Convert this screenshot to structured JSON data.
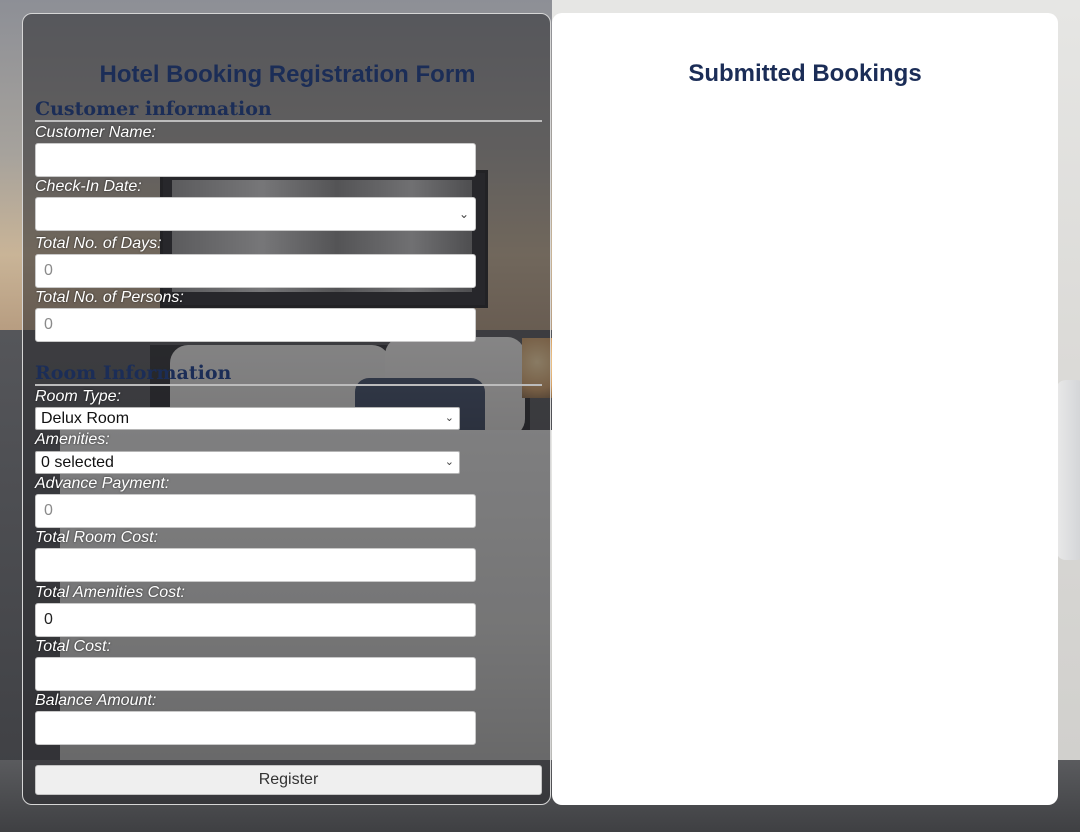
{
  "form": {
    "title": "Hotel Booking Registration Form",
    "customer_section": "Customer information",
    "customer_name_label": "Customer Name:",
    "customer_name_value": "",
    "checkin_label": "Check-In Date:",
    "checkin_value": "",
    "days_label": "Total No. of Days:",
    "days_placeholder": "0",
    "persons_label": "Total No. of Persons:",
    "persons_placeholder": "0",
    "room_section": "Room Information",
    "room_type_label": "Room Type:",
    "room_type_value": "Delux Room",
    "amenities_label": "Amenities:",
    "amenities_value": "0 selected",
    "advance_label": "Advance Payment:",
    "advance_placeholder": "0",
    "room_cost_label": "Total Room Cost:",
    "room_cost_value": "",
    "amenities_cost_label": "Total Amenities Cost:",
    "amenities_cost_value": "0",
    "total_cost_label": "Total Cost:",
    "total_cost_value": "",
    "balance_label": "Balance Amount:",
    "balance_value": "",
    "register_label": "Register"
  },
  "bookings": {
    "title": "Submitted Bookings"
  },
  "icons": {
    "dropdown": "chevron-down-icon"
  },
  "colors": {
    "heading": "#1b2d57",
    "panel_white": "#ffffff"
  }
}
